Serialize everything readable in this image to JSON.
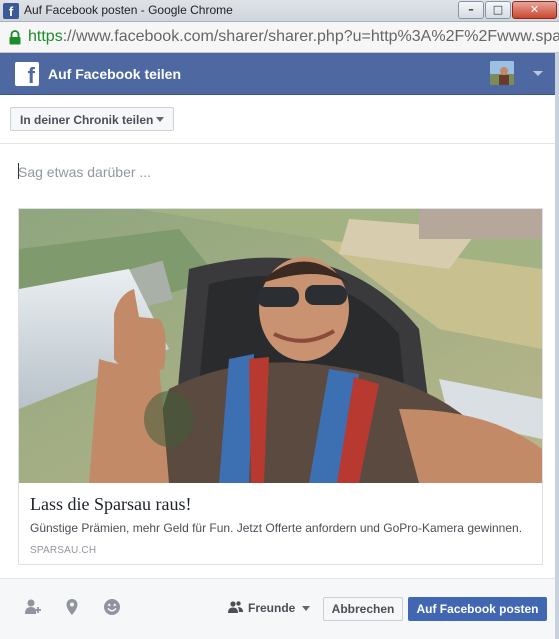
{
  "browser": {
    "window_title": "Auf Facebook posten - Google Chrome",
    "url_scheme": "https",
    "url_rest": "://www.facebook.com/sharer/sharer.php?u=http%3A%2F%2Fwww.spar",
    "buttons": {
      "minimize": "–",
      "maximize": "□",
      "close": "✕"
    }
  },
  "header": {
    "logo_letter": "f",
    "title": "Auf Facebook teilen"
  },
  "share_target": {
    "label": "In deiner Chronik teilen"
  },
  "composer": {
    "placeholder": "Sag etwas darüber ..."
  },
  "link_preview": {
    "title": "Lass die Sparsau raus!",
    "description": "Günstige Prämien, mehr Geld für Fun. Jetzt Offerte anfordern und GoPro-Kamera gewinnen.",
    "domain": "SPARSAU.CH"
  },
  "footer": {
    "icons": [
      "tag-friends-icon",
      "location-pin-icon",
      "feeling-smiley-icon"
    ],
    "audience_label": "Freunde",
    "cancel_label": "Abbrechen",
    "post_label": "Auf Facebook posten"
  },
  "colors": {
    "facebook_blue": "#4e69a2",
    "button_blue": "#4267b2",
    "https_green": "#1c8c2d"
  }
}
